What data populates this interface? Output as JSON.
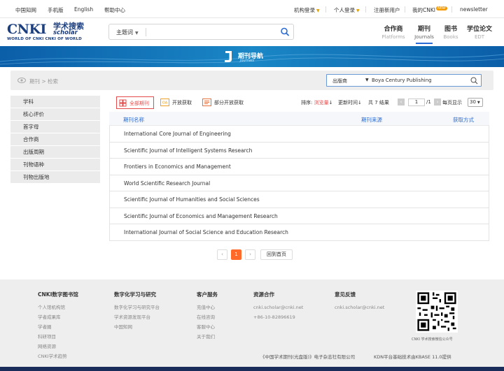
{
  "topbar": {
    "cnki_cn": "中国知网",
    "mobile": "手机版",
    "english": "English",
    "help": "帮助中心",
    "institution_login": "机构登录",
    "personal_login": "个人登录",
    "register": "注册新用户",
    "my_cnki": "我的CNKI",
    "new_badge": "NEW",
    "newsletter": "newsletter"
  },
  "header": {
    "logo_big": "CNKI",
    "logo_cn": "学术搜索",
    "logo_scholar": "scholar",
    "logo_tagline": "WORLD OF CNKI CNKI OF WORLD",
    "search_field": "主题词",
    "search_value": "",
    "tabs": [
      {
        "zh": "合作商",
        "en": "Platforms",
        "active": false
      },
      {
        "zh": "期刊",
        "en": "Journals",
        "active": true
      },
      {
        "zh": "图书",
        "en": "Books",
        "active": false
      },
      {
        "zh": "学位论文",
        "en": "EDT",
        "active": false
      }
    ]
  },
  "banner": {
    "title": "期刊导航",
    "subtitle": "Journals"
  },
  "breadcrumb": "期刊 > 检索",
  "publisher_filter": {
    "label": "出版商",
    "value": "Boya Century Publishing"
  },
  "sidebar": {
    "items": [
      "学科",
      "核心评价",
      "首字母",
      "合作商",
      "出版周期",
      "刊物语种",
      "刊物出版地"
    ]
  },
  "filters": {
    "all": "全部期刊",
    "open": "开放获取",
    "partial": "部分开放获取",
    "sort_label": "排序:",
    "sort_hot": "浏览量",
    "sort_update": "更新时间",
    "total_label": "共 7 结果",
    "page_current": "1",
    "page_total": "/1",
    "per_page_label": "每页显示",
    "per_page_value": "30"
  },
  "table": {
    "headers": [
      "期刊名称",
      "期刊来源",
      "获取方式"
    ],
    "rows": [
      "International Core Journal of Engineering",
      "Scientific Journal of Intelligent Systems Research",
      "Frontiers in Economics and Management",
      "World Scientific Research Journal",
      "Scientific Journal of Humanities and Social Sciences",
      "Scientific Journal of Economics and Management Research",
      "International Journal of Social Science and Education Research"
    ]
  },
  "pager": {
    "prev": "‹",
    "current": "1",
    "next": "›",
    "home": "回到首页"
  },
  "footer": {
    "col1": {
      "title": "CNKI数字图书馆",
      "links": [
        "个人馆机构馆",
        "学者成果库",
        "学者圈",
        "科研项目",
        "网络资源",
        "CNKI学术趋势"
      ]
    },
    "col2": {
      "title": "数字化学习与研究",
      "links": [
        "数字化学习与研究平台",
        "学术资源发现平台",
        "中国知网"
      ]
    },
    "col3": {
      "title": "客户服务",
      "links": [
        "充值中心",
        "在线咨询",
        "客服中心",
        "关于我们"
      ]
    },
    "col4": {
      "title": "资源合作",
      "links": [
        "cnki.scholar@cnki.net",
        "+86-10-82896619"
      ]
    },
    "col5": {
      "title": "意见反馈",
      "links": [
        "cnki.scholar@cnki.net"
      ]
    },
    "qr_caption": "CNKI 学术搜索微信公众号",
    "copyright": "《中国学术期刊(光盘版)》电子杂志社有限公司",
    "tech": "KDN平台基础技术由KBASE 11.0提供"
  },
  "colors": {
    "brand_blue": "#1d3f7e",
    "accent_blue": "#2a6bd6",
    "accent_red": "#e54b4b",
    "pager_orange": "#ff6a2b",
    "banner_blue": "#0b5ea8"
  }
}
